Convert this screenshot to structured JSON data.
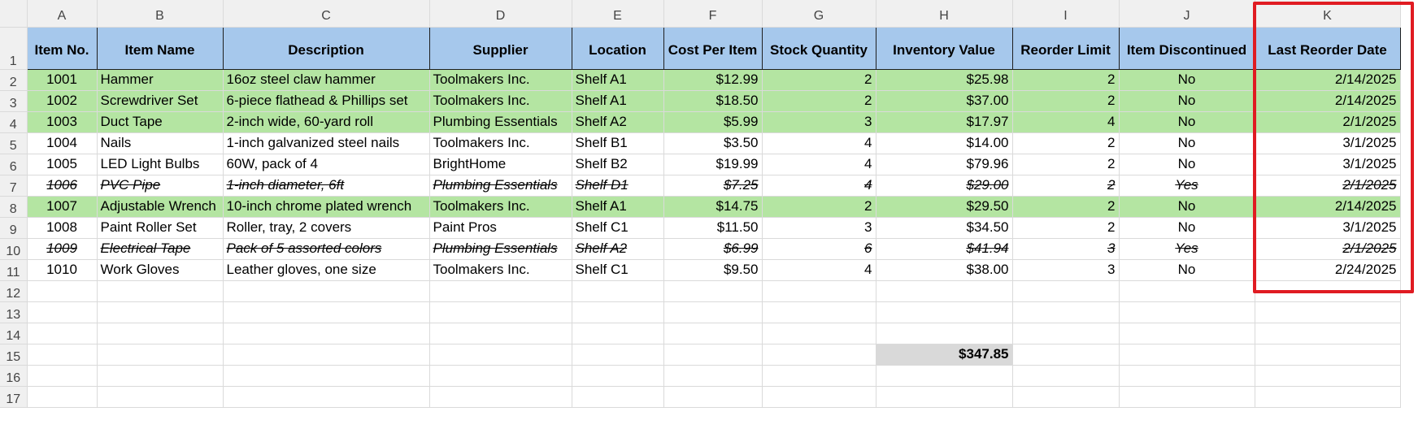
{
  "column_letters": [
    "A",
    "B",
    "C",
    "D",
    "E",
    "F",
    "G",
    "H",
    "I",
    "J",
    "K"
  ],
  "row_numbers": [
    "1",
    "2",
    "3",
    "4",
    "5",
    "6",
    "7",
    "8",
    "9",
    "10",
    "11",
    "12",
    "13",
    "14",
    "15",
    "16",
    "17"
  ],
  "headers": [
    "Item No.",
    "Item Name",
    "Description",
    "Supplier",
    "Location",
    "Cost Per Item",
    "Stock Quantity",
    "Inventory Value",
    "Reorder Limit",
    "Item Discontinued",
    "Last Reorder Date"
  ],
  "rows": [
    {
      "cells": [
        "1001",
        "Hammer",
        "16oz steel claw hammer",
        "Toolmakers Inc.",
        "Shelf A1",
        "$12.99",
        "2",
        "$25.98",
        "2",
        "No",
        "2/14/2025"
      ],
      "highlight": "green",
      "discontinued": false
    },
    {
      "cells": [
        "1002",
        "Screwdriver Set",
        "6-piece flathead & Phillips set",
        "Toolmakers Inc.",
        "Shelf A1",
        "$18.50",
        "2",
        "$37.00",
        "2",
        "No",
        "2/14/2025"
      ],
      "highlight": "green",
      "discontinued": false
    },
    {
      "cells": [
        "1003",
        "Duct Tape",
        "2-inch wide, 60-yard roll",
        "Plumbing Essentials",
        "Shelf A2",
        "$5.99",
        "3",
        "$17.97",
        "4",
        "No",
        "2/1/2025"
      ],
      "highlight": "green",
      "discontinued": false
    },
    {
      "cells": [
        "1004",
        "Nails",
        "1-inch galvanized steel nails",
        "Toolmakers Inc.",
        "Shelf B1",
        "$3.50",
        "4",
        "$14.00",
        "2",
        "No",
        "3/1/2025"
      ],
      "highlight": "none",
      "discontinued": false
    },
    {
      "cells": [
        "1005",
        "LED Light Bulbs",
        "60W, pack of 4",
        "BrightHome",
        "Shelf B2",
        "$19.99",
        "4",
        "$79.96",
        "2",
        "No",
        "3/1/2025"
      ],
      "highlight": "none",
      "discontinued": false
    },
    {
      "cells": [
        "1006",
        "PVC Pipe",
        "1-inch diameter, 6ft",
        "Plumbing Essentials",
        "Shelf D1",
        "$7.25",
        "4",
        "$29.00",
        "2",
        "Yes",
        "2/1/2025"
      ],
      "highlight": "none",
      "discontinued": true
    },
    {
      "cells": [
        "1007",
        "Adjustable Wrench",
        "10-inch chrome plated wrench",
        "Toolmakers Inc.",
        "Shelf A1",
        "$14.75",
        "2",
        "$29.50",
        "2",
        "No",
        "2/14/2025"
      ],
      "highlight": "green",
      "discontinued": false
    },
    {
      "cells": [
        "1008",
        "Paint Roller Set",
        "Roller, tray, 2 covers",
        "Paint Pros",
        "Shelf C1",
        "$11.50",
        "3",
        "$34.50",
        "2",
        "No",
        "3/1/2025"
      ],
      "highlight": "none",
      "discontinued": false
    },
    {
      "cells": [
        "1009",
        "Electrical Tape",
        "Pack of 5 assorted colors",
        "Plumbing Essentials",
        "Shelf A2",
        "$6.99",
        "6",
        "$41.94",
        "3",
        "Yes",
        "2/1/2025"
      ],
      "highlight": "none",
      "discontinued": true
    },
    {
      "cells": [
        "1010",
        "Work Gloves",
        "Leather gloves, one size",
        "Toolmakers Inc.",
        "Shelf C1",
        "$9.50",
        "4",
        "$38.00",
        "3",
        "No",
        "2/24/2025"
      ],
      "highlight": "none",
      "discontinued": false
    }
  ],
  "total_inventory_value": "$347.85",
  "colors": {
    "header_fill": "#a6c8ec",
    "highlight_fill": "#b4e5a2",
    "total_fill": "#d9d9d9",
    "annotation_box": "#e01b22"
  }
}
